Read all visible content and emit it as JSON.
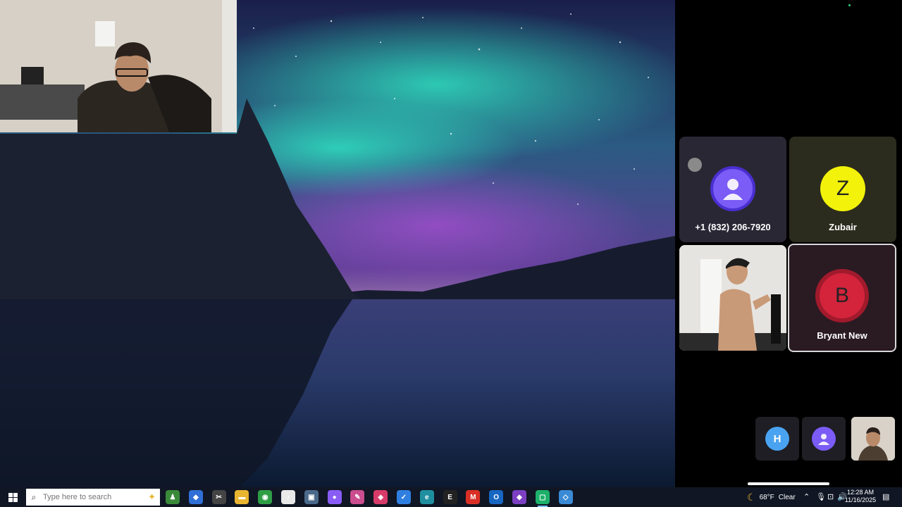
{
  "participants": [
    {
      "name": "+1 (832) 206-7920",
      "initial": "",
      "color": "#7b5cf6"
    },
    {
      "name": "Zubair",
      "initial": "Z",
      "color": "#f2f20a"
    },
    {
      "name": "",
      "initial": "",
      "color": "#cfcfcf"
    },
    {
      "name": "Bryant New",
      "initial": "B",
      "color": "#d3243c"
    }
  ],
  "mini_participants": [
    {
      "initial": "H",
      "color": "#4aa3f0"
    },
    {
      "initial": "",
      "color": "#7b5cf6"
    },
    {
      "initial": "",
      "color": "#8a6b4f"
    }
  ],
  "taskbar": {
    "search_placeholder": "Type here to search",
    "apps": [
      {
        "name": "chess-app",
        "label": "♟",
        "color": "#3a8a3a"
      },
      {
        "name": "copilot-app",
        "label": "◆",
        "color": "#2f6fd6"
      },
      {
        "name": "tool-app",
        "label": "✂",
        "color": "#444"
      },
      {
        "name": "file-explorer-app",
        "label": "▬",
        "color": "#e9b530"
      },
      {
        "name": "chrome-app",
        "label": "◉",
        "color": "#2e9e45"
      },
      {
        "name": "music-app",
        "label": "♪",
        "color": "#e9e9e9"
      },
      {
        "name": "monitor-app",
        "label": "▣",
        "color": "#4b6a8a"
      },
      {
        "name": "messenger-app",
        "label": "●",
        "color": "#8a5cf6"
      },
      {
        "name": "paint-app",
        "label": "✎",
        "color": "#c94d8f"
      },
      {
        "name": "store-app",
        "label": "◈",
        "color": "#d63b6a"
      },
      {
        "name": "todo-app",
        "label": "✓",
        "color": "#2f7fe0"
      },
      {
        "name": "edge-app",
        "label": "e",
        "color": "#1f8fa0"
      },
      {
        "name": "editor-app",
        "label": "E",
        "color": "#222"
      },
      {
        "name": "gmail-app",
        "label": "M",
        "color": "#d93025"
      },
      {
        "name": "outlook-app",
        "label": "O",
        "color": "#1766c2"
      },
      {
        "name": "photos-app",
        "label": "◆",
        "color": "#7a3fc2"
      },
      {
        "name": "meet-app",
        "label": "▢",
        "color": "#1db06a"
      },
      {
        "name": "remote-app",
        "label": "◇",
        "color": "#3a8ad6"
      }
    ],
    "weather_temp": "68°F",
    "weather_text": "Clear",
    "time": "12:28 AM",
    "date": "11/16/2025"
  }
}
